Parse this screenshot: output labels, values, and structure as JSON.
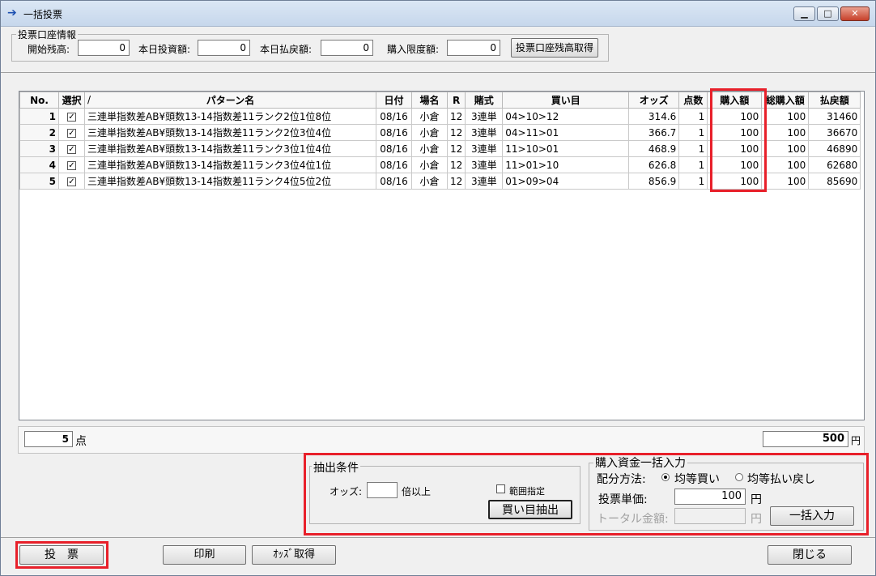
{
  "window": {
    "title": "一括投票",
    "controls": {
      "minimize": "▁",
      "maximize": "□",
      "close": "✕"
    }
  },
  "account": {
    "group_label": "投票口座情報",
    "start_balance_label": "開始残高:",
    "start_balance": "0",
    "today_invest_label": "本日投資額:",
    "today_invest": "0",
    "today_payout_label": "本日払戻額:",
    "today_payout": "0",
    "purchase_limit_label": "購入限度額:",
    "purchase_limit": "0",
    "fetch_button": "投票口座残高取得"
  },
  "table": {
    "headers": {
      "no": "No.",
      "select": "選択",
      "slash": "/",
      "pattern": "パターン名",
      "date": "日付",
      "venue": "場名",
      "race": "R",
      "bet_type": "賭式",
      "combo": "買い目",
      "odds": "オッズ",
      "points": "点数",
      "amount": "購入額",
      "total_amount": "総購入額",
      "payout": "払戻額"
    },
    "rows": [
      {
        "no": "1",
        "pattern": "三連単指数差AB¥頭数13-14指数差11ランク2位1位8位",
        "date": "08/16",
        "venue": "小倉",
        "race": "12",
        "bet_type": "3連単",
        "combo": "04>10>12",
        "odds": "314.6",
        "points": "1",
        "amount": "100",
        "total_amount": "100",
        "payout": "31460"
      },
      {
        "no": "2",
        "pattern": "三連単指数差AB¥頭数13-14指数差11ランク2位3位4位",
        "date": "08/16",
        "venue": "小倉",
        "race": "12",
        "bet_type": "3連単",
        "combo": "04>11>01",
        "odds": "366.7",
        "points": "1",
        "amount": "100",
        "total_amount": "100",
        "payout": "36670"
      },
      {
        "no": "3",
        "pattern": "三連単指数差AB¥頭数13-14指数差11ランク3位1位4位",
        "date": "08/16",
        "venue": "小倉",
        "race": "12",
        "bet_type": "3連単",
        "combo": "11>10>01",
        "odds": "468.9",
        "points": "1",
        "amount": "100",
        "total_amount": "100",
        "payout": "46890"
      },
      {
        "no": "4",
        "pattern": "三連単指数差AB¥頭数13-14指数差11ランク3位4位1位",
        "date": "08/16",
        "venue": "小倉",
        "race": "12",
        "bet_type": "3連単",
        "combo": "11>01>10",
        "odds": "626.8",
        "points": "1",
        "amount": "100",
        "total_amount": "100",
        "payout": "62680"
      },
      {
        "no": "5",
        "pattern": "三連単指数差AB¥頭数13-14指数差11ランク4位5位2位",
        "date": "08/16",
        "venue": "小倉",
        "race": "12",
        "bet_type": "3連単",
        "combo": "01>09>04",
        "odds": "856.9",
        "points": "1",
        "amount": "100",
        "total_amount": "100",
        "payout": "85690"
      }
    ],
    "check_mark": "✓"
  },
  "summary": {
    "count": "5",
    "count_unit": "点",
    "total": "500",
    "total_unit": "円"
  },
  "extract": {
    "group_label": "抽出条件",
    "odds_label": "オッズ:",
    "odds_value": "",
    "odds_suffix": "倍以上",
    "range_label": "範囲指定",
    "extract_button": "買い目抽出"
  },
  "bulk": {
    "group_label": "購入資金一括入力",
    "method_label": "配分方法:",
    "option_equal_buy": "均等買い",
    "option_equal_payout": "均等払い戻し",
    "unit_price_label": "投票単価:",
    "unit_price": "100",
    "unit_price_unit": "円",
    "total_label": "トータル金額:",
    "total_value": "",
    "total_unit": "円",
    "apply_button": "一括入力"
  },
  "footer": {
    "vote_button": "投　票",
    "print_button": "印刷",
    "odds_button": "ｵｯｽﾞ取得",
    "close_button": "閉じる"
  },
  "colors": {
    "highlight": "#e8202a",
    "title_icon": "#1b4fb0"
  }
}
